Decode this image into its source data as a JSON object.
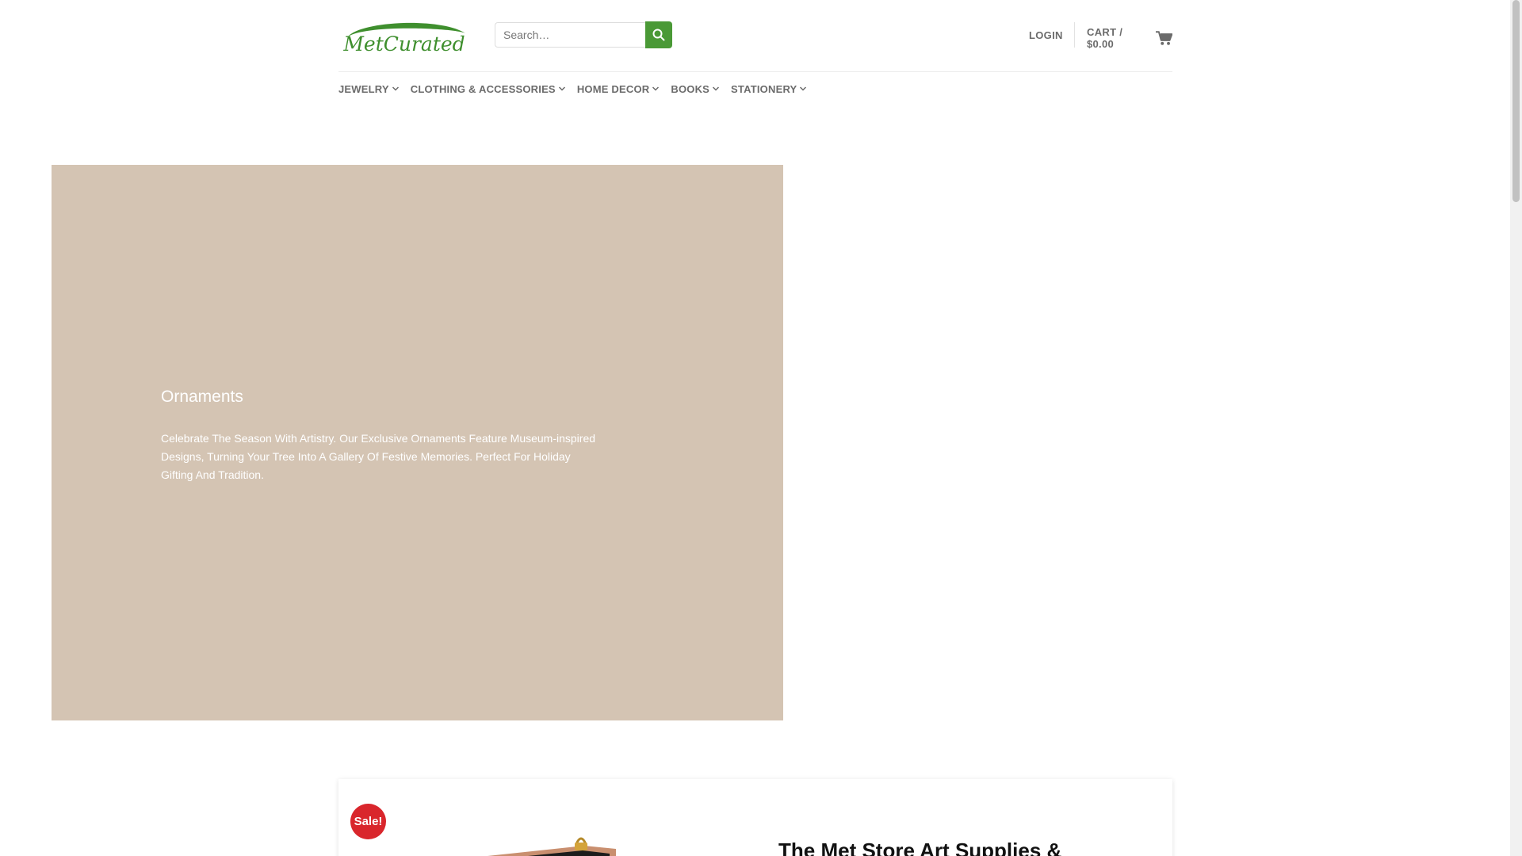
{
  "brand": {
    "logo_text": "MetCurated",
    "accent_color": "#4a9936",
    "logo_color": "#3f8f2e"
  },
  "header": {
    "search_placeholder": "Search…",
    "search_button_icon": "search-icon",
    "login_label": "LOGIN",
    "cart_label": "CART / $0.00",
    "cart_icon": "cart-icon"
  },
  "nav": {
    "items": [
      {
        "label": "JEWELRY"
      },
      {
        "label": "CLOTHING & ACCESSORIES"
      },
      {
        "label": "HOME DECOR"
      },
      {
        "label": "BOOKS"
      },
      {
        "label": "STATIONERY"
      }
    ]
  },
  "banner": {
    "title": "Ornaments",
    "text": "Celebrate The Season With Artistry. Our Exclusive Ornaments Feature Museum-inspired Designs, Turning Your Tree Into A Gallery Of Festive Memories. Perfect For Holiday Gifting And Tradition.",
    "background_color": "#d4c4b3"
  },
  "product": {
    "badge": "Sale!",
    "badge_color": "#d9262c",
    "title": "The Met Store Art Supplies &"
  }
}
